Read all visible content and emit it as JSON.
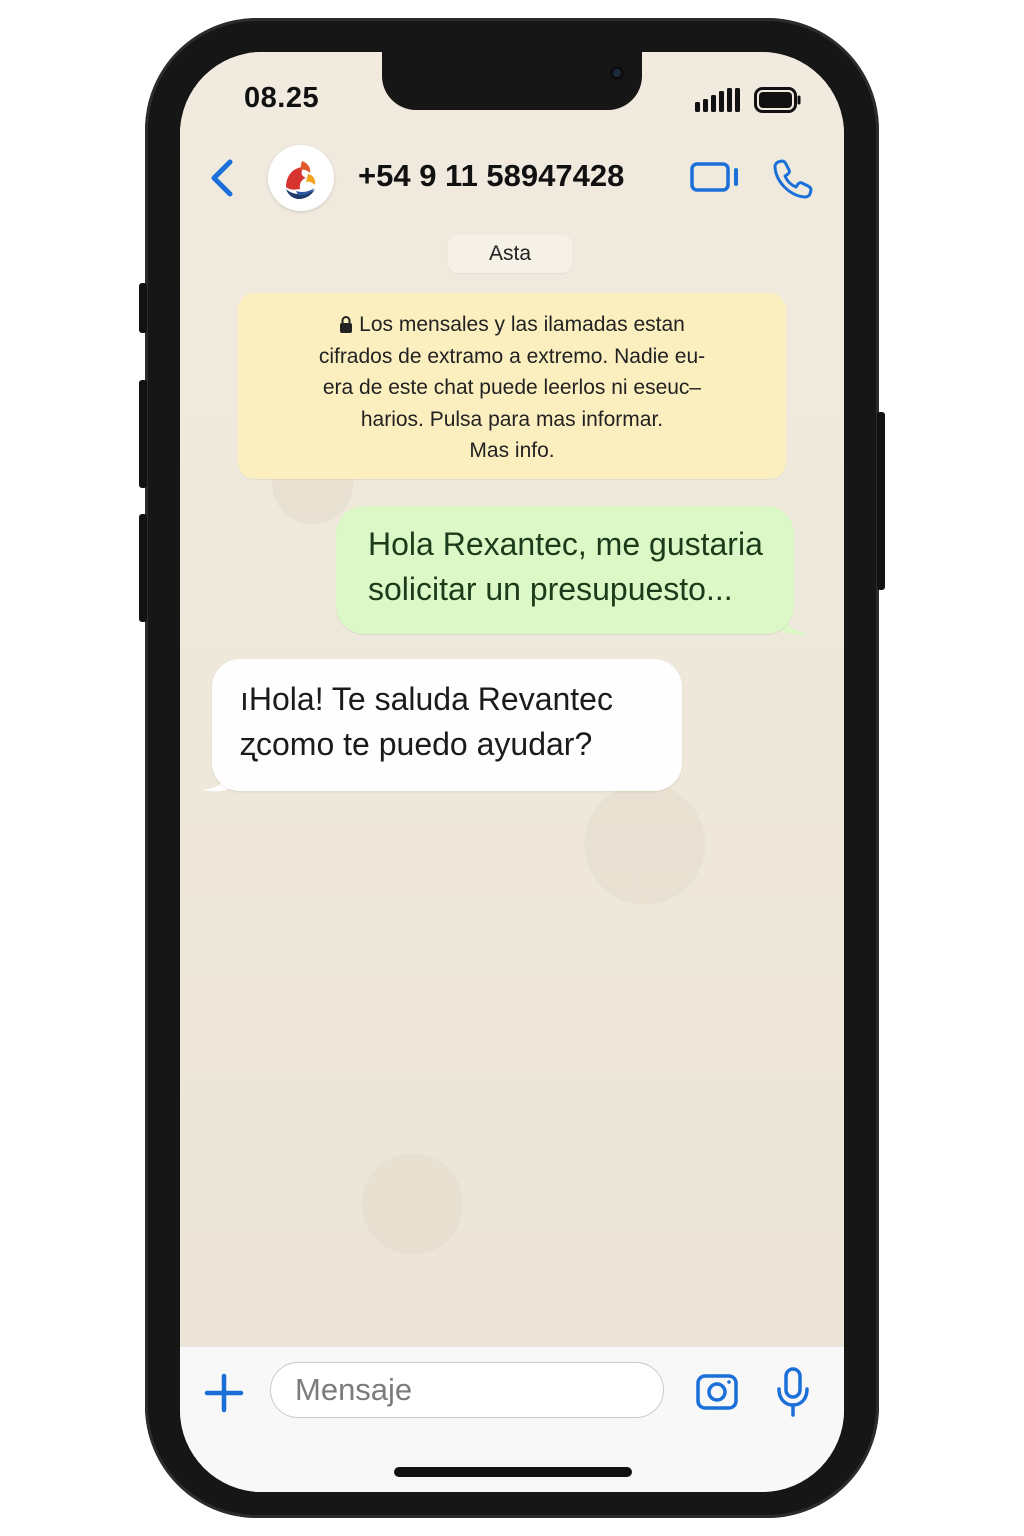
{
  "status_bar": {
    "time": "08.25"
  },
  "header": {
    "back_icon": "chevron-left-icon",
    "contact_name": "+54 9 11 58947428",
    "video_icon": "video-camera-icon",
    "call_icon": "phone-icon"
  },
  "chat": {
    "date_chip": "Asta",
    "security_notice": {
      "lines": [
        "Los mensales y las ilamadas estan",
        "cifrados de extramo a extremo. Nadie eu-",
        "era de este chat puede leerlos ni eseuc–",
        "harios. Pulsa para mas informar.",
        "Mas info."
      ]
    },
    "messages": [
      {
        "direction": "outgoing",
        "lines": [
          "Hola Rexantec, me gustaria",
          "solicitar un presupuesto..."
        ]
      },
      {
        "direction": "incoming",
        "lines": [
          "ıHola! Te saluda Revantec",
          "ʐcomo te puedo ayudar?"
        ]
      }
    ]
  },
  "composer": {
    "placeholder": "Mensaje",
    "value": ""
  },
  "colors": {
    "accent": "#1a6fd8",
    "outgoing_bubble": "#dcf8c6",
    "incoming_bubble": "#fefefe",
    "notice_bg": "#fbefc0",
    "chat_bg": "#eee8dc"
  }
}
